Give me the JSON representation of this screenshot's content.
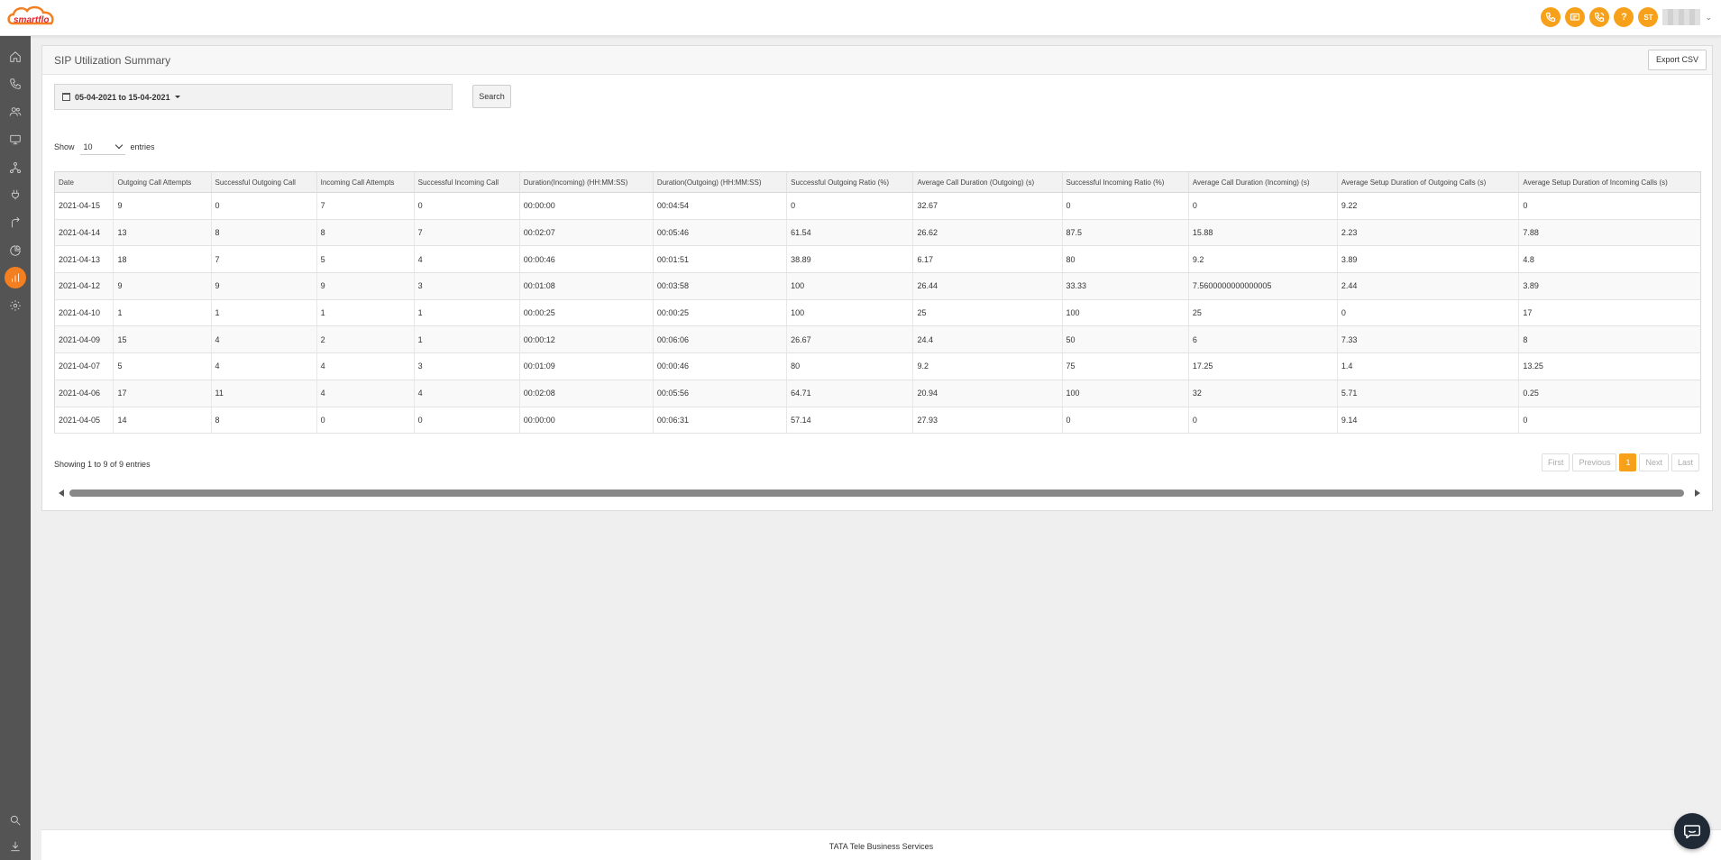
{
  "app": {
    "logo_text": "smartflo",
    "footer_text": "TATA Tele Business Services"
  },
  "header": {
    "avatar_initials": "ST",
    "icons": [
      "phone-icon",
      "message-icon",
      "phone-call-icon",
      "help-icon"
    ],
    "help_glyph": "?"
  },
  "sidebar": {
    "items": [
      "home-icon",
      "phone-icon",
      "users-icon",
      "monitor-icon",
      "hierarchy-icon",
      "plug-icon",
      "route-icon",
      "pie-chart-icon",
      "bar-chart-icon",
      "settings-icon",
      "search-icon",
      "download-icon"
    ],
    "active": "bar-chart-icon"
  },
  "panel": {
    "title": "SIP Utilization Summary",
    "export_label": "Export CSV",
    "date_range": "05-04-2021 to 15-04-2021",
    "search_label": "Search",
    "show_label": "Show",
    "entries_value": "10",
    "entries_label": "entries",
    "showing_info": "Showing 1 to 9 of 9 entries"
  },
  "table": {
    "columns": [
      "Date",
      "Outgoing Call Attempts",
      "Successful Outgoing Call",
      "Incoming Call Attempts",
      "Successful Incoming Call",
      "Duration(Incoming) (HH:MM:SS)",
      "Duration(Outgoing) (HH:MM:SS)",
      "Successful Outgoing Ratio (%)",
      "Average Call Duration (Outgoing) (s)",
      "Successful Incoming Ratio (%)",
      "Average Call Duration (Incoming) (s)",
      "Average Setup Duration of Outgoing Calls (s)",
      "Average Setup Duration of Incoming Calls (s)"
    ],
    "rows": [
      [
        "2021-04-15",
        "9",
        "0",
        "7",
        "0",
        "00:00:00",
        "00:04:54",
        "0",
        "32.67",
        "0",
        "0",
        "9.22",
        "0"
      ],
      [
        "2021-04-14",
        "13",
        "8",
        "8",
        "7",
        "00:02:07",
        "00:05:46",
        "61.54",
        "26.62",
        "87.5",
        "15.88",
        "2.23",
        "7.88"
      ],
      [
        "2021-04-13",
        "18",
        "7",
        "5",
        "4",
        "00:00:46",
        "00:01:51",
        "38.89",
        "6.17",
        "80",
        "9.2",
        "3.89",
        "4.8"
      ],
      [
        "2021-04-12",
        "9",
        "9",
        "9",
        "3",
        "00:01:08",
        "00:03:58",
        "100",
        "26.44",
        "33.33",
        "7.5600000000000005",
        "2.44",
        "3.89"
      ],
      [
        "2021-04-10",
        "1",
        "1",
        "1",
        "1",
        "00:00:25",
        "00:00:25",
        "100",
        "25",
        "100",
        "25",
        "0",
        "17"
      ],
      [
        "2021-04-09",
        "15",
        "4",
        "2",
        "1",
        "00:00:12",
        "00:06:06",
        "26.67",
        "24.4",
        "50",
        "6",
        "7.33",
        "8"
      ],
      [
        "2021-04-07",
        "5",
        "4",
        "4",
        "3",
        "00:01:09",
        "00:00:46",
        "80",
        "9.2",
        "75",
        "17.25",
        "1.4",
        "13.25"
      ],
      [
        "2021-04-06",
        "17",
        "11",
        "4",
        "4",
        "00:02:08",
        "00:05:56",
        "64.71",
        "20.94",
        "100",
        "32",
        "5.71",
        "0.25"
      ],
      [
        "2021-04-05",
        "14",
        "8",
        "0",
        "0",
        "00:00:00",
        "00:06:31",
        "57.14",
        "27.93",
        "0",
        "0",
        "9.14",
        "0"
      ]
    ]
  },
  "pagination": {
    "first": "First",
    "previous": "Previous",
    "current": "1",
    "next": "Next",
    "last": "Last"
  },
  "colors": {
    "accent": "#f7a11a",
    "sidebar_bg": "#545454",
    "active_nav": "#f47f20"
  }
}
